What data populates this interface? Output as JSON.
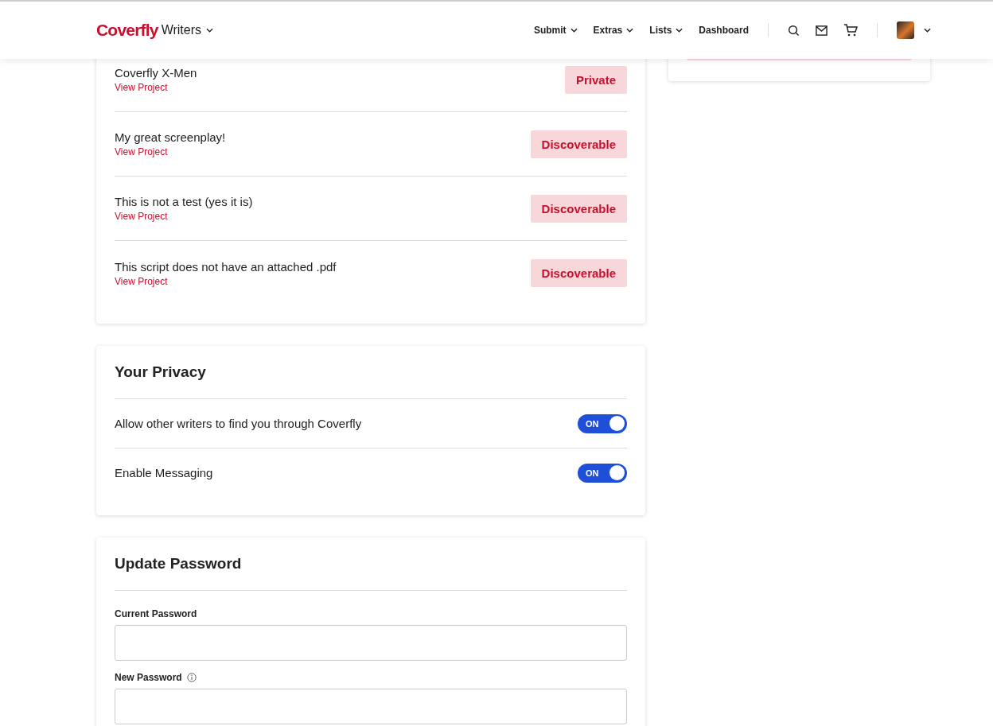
{
  "header": {
    "logo": "Coverfly",
    "product": "Writers",
    "nav": [
      {
        "label": "Submit",
        "dropdown": true
      },
      {
        "label": "Extras",
        "dropdown": true
      },
      {
        "label": "Lists",
        "dropdown": true
      },
      {
        "label": "Dashboard",
        "dropdown": false
      }
    ]
  },
  "projects": [
    {
      "title": "Coverfly X-Men",
      "link": "View Project",
      "status": "Private"
    },
    {
      "title": "My great screenplay!",
      "link": "View Project",
      "status": "Discoverable"
    },
    {
      "title": "This is not a test (yes it is)",
      "link": "View Project",
      "status": "Discoverable"
    },
    {
      "title": "This script does not have an attached .pdf",
      "link": "View Project",
      "status": "Discoverable"
    }
  ],
  "privacy": {
    "title": "Your Privacy",
    "settings": [
      {
        "label": "Allow other writers to find you through Coverfly",
        "on": true,
        "state_label": "ON"
      },
      {
        "label": "Enable Messaging",
        "on": true,
        "state_label": "ON"
      }
    ]
  },
  "password": {
    "title": "Update Password",
    "fields": [
      {
        "label": "Current Password",
        "info": false
      },
      {
        "label": "New Password",
        "info": true
      }
    ]
  }
}
